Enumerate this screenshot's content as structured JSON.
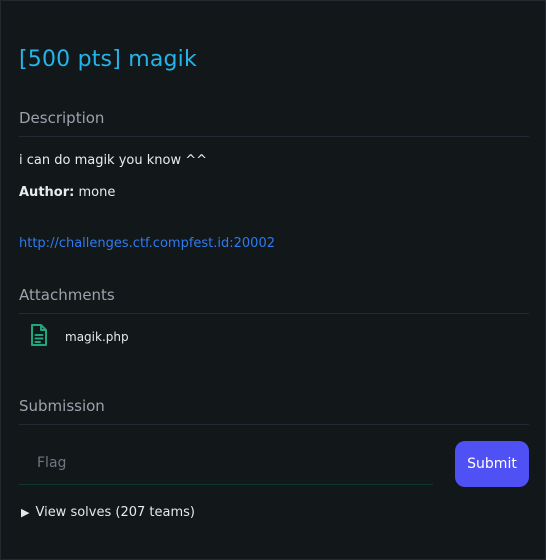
{
  "challenge": {
    "title": "[500 pts] magik"
  },
  "description": {
    "heading": "Description",
    "text": "i can do magik you know ^^",
    "author_label": "Author:",
    "author_name": "mone",
    "link": "http://challenges.ctf.compfest.id:20002"
  },
  "attachments": {
    "heading": "Attachments",
    "files": [
      {
        "name": "magik.php",
        "icon": "file-icon"
      }
    ]
  },
  "submission": {
    "heading": "Submission",
    "flag_placeholder": "Flag",
    "flag_value": "",
    "submit_label": "Submit",
    "view_solves": "View solves (207 teams)",
    "expand_icon": "triangle-right-icon"
  },
  "colors": {
    "title": "#22b4ea",
    "link": "#2e7bf0",
    "submit_button": "#4f51f5",
    "file_icon": "#1fa67a",
    "background": "#12171a"
  }
}
